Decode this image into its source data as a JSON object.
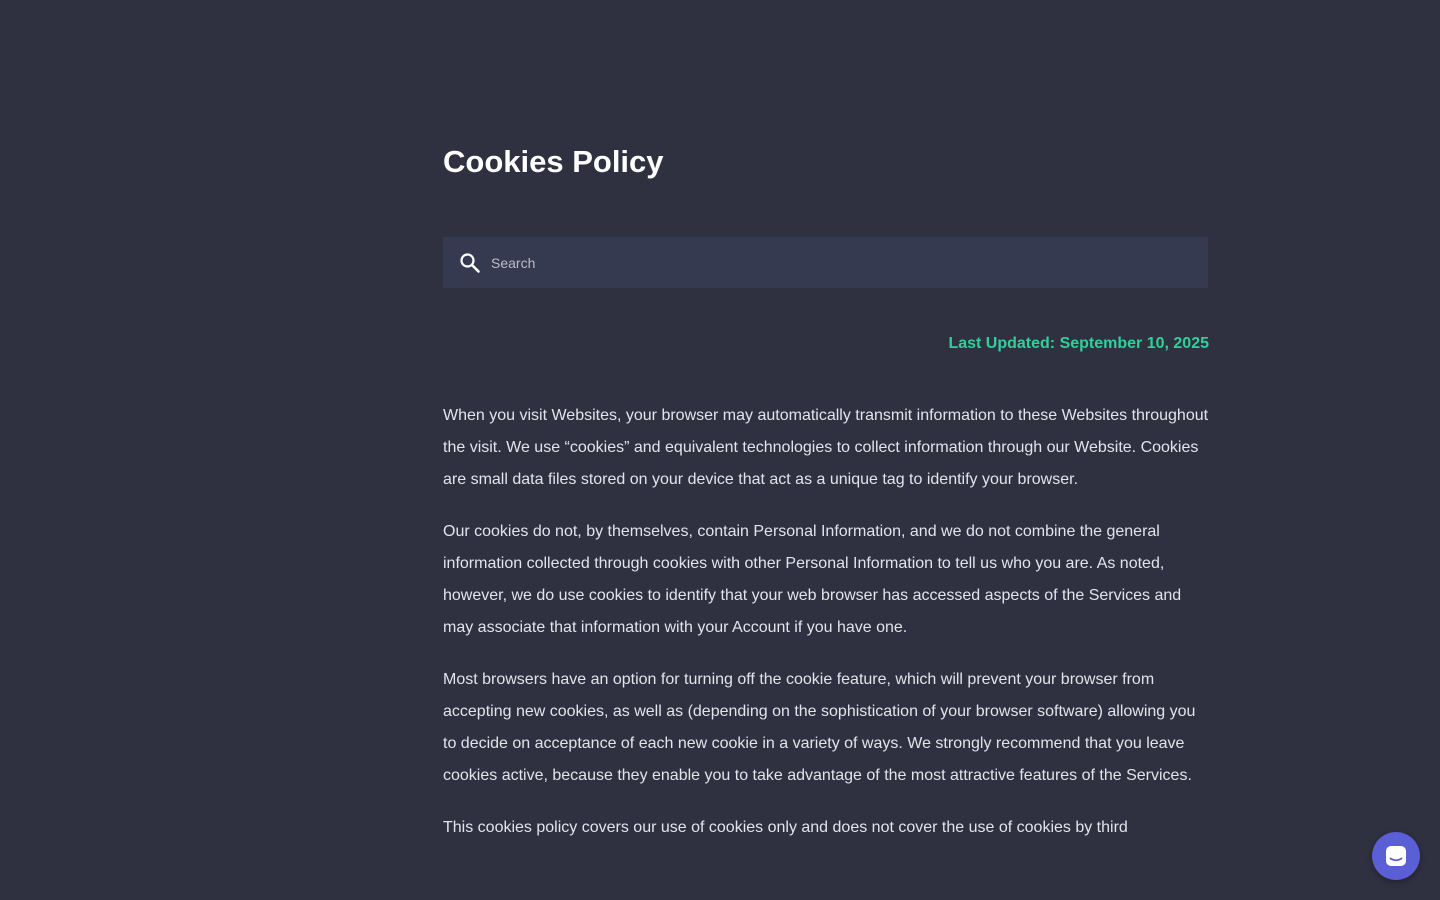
{
  "page": {
    "title": "Cookies Policy",
    "last_updated": "Last Updated: September 10, 2025"
  },
  "search": {
    "placeholder": "Search",
    "value": ""
  },
  "body": {
    "paragraphs": [
      "When you visit Websites, your browser may automatically transmit information to these Websites throughout the visit. We use “cookies” and equivalent technologies to collect information through our Website. Cookies are small data files stored on your device that act as a unique tag to identify your browser.",
      "Our cookies do not, by themselves, contain Personal Information, and we do not combine the general information collected through cookies with other Personal Information to tell us who you are. As noted, however, we do use cookies to identify that your web browser has accessed aspects of the Services and may associate that information with your Account if you have one.",
      "Most browsers have an option for turning off the cookie feature, which will prevent your browser from accepting new cookies, as well as (depending on the sophistication of your browser software) allowing you to decide on acceptance of each new cookie in a variety of ways. We strongly recommend that you leave cookies active, because they enable you to take advantage of the most attractive features of the Services.",
      "This cookies policy covers our use of cookies only and does not cover the use of cookies by third"
    ]
  },
  "icons": {
    "search": "search-icon",
    "chat": "chat-icon"
  },
  "colors": {
    "background": "#2f3040",
    "search_background": "#363a50",
    "accent_green": "#2fd19a",
    "chat_button": "#5b5fd6"
  }
}
